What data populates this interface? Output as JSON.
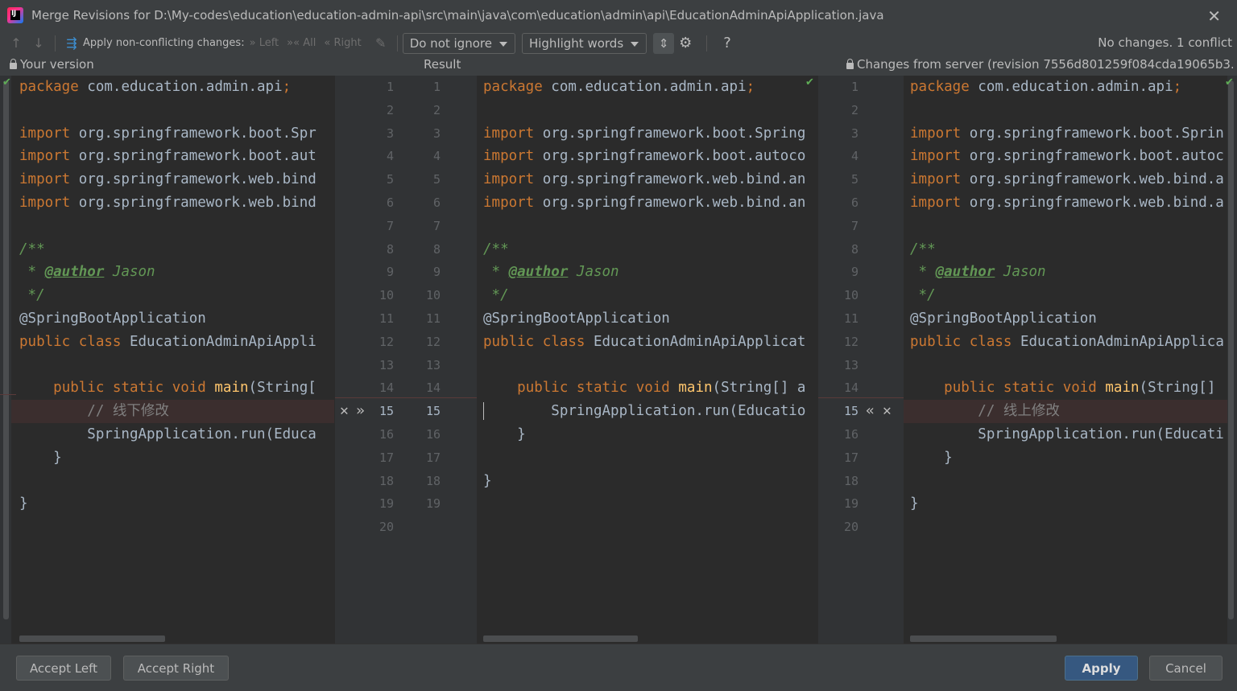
{
  "window": {
    "title": "Merge Revisions for D:\\My-codes\\education\\education-admin-api\\src\\main\\java\\com\\education\\admin\\api\\EducationAdminApiApplication.java",
    "logo_text": "IJ"
  },
  "toolbar": {
    "apply_label": "Apply non-conflicting changes:",
    "left_label": "Left",
    "all_label": "All",
    "right_label": "Right",
    "ignore_dropdown": "Do not ignore",
    "highlight_dropdown": "Highlight words",
    "status": "No changes. 1 conflict",
    "help": "?"
  },
  "panes": {
    "left_title": "Your version",
    "middle_title": "Result",
    "right_title": "Changes from server (revision 7556d801259f084cda19065b3..."
  },
  "left_code": [
    "package com.education.admin.api;",
    "",
    "import org.springframework.boot.Spr",
    "import org.springframework.boot.aut",
    "import org.springframework.web.bind",
    "import org.springframework.web.bind",
    "",
    "/**",
    " * @author Jason",
    " */",
    "@SpringBootApplication",
    "public class EducationAdminApiAppli",
    "",
    "    public static void main(String[",
    "        // 线下修改",
    "        SpringApplication.run(Educa",
    "    }",
    "",
    "}",
    ""
  ],
  "middle_code": [
    "package com.education.admin.api;",
    "",
    "import org.springframework.boot.Spring",
    "import org.springframework.boot.autoco",
    "import org.springframework.web.bind.an",
    "import org.springframework.web.bind.an",
    "",
    "/**",
    " * @author Jason",
    " */",
    "@SpringBootApplication",
    "public class EducationAdminApiApplicat",
    "",
    "    public static void main(String[] a",
    "        SpringApplication.run(Educatio",
    "    }",
    "",
    "}",
    ""
  ],
  "right_code": [
    "package com.education.admin.api;",
    "",
    "import org.springframework.boot.Sprin",
    "import org.springframework.boot.autoc",
    "import org.springframework.web.bind.a",
    "import org.springframework.web.bind.a",
    "",
    "/**",
    " * @author Jason",
    " */",
    "@SpringBootApplication",
    "public class EducationAdminApiApplica",
    "",
    "    public static void main(String[]",
    "        // 线上修改",
    "        SpringApplication.run(Educati",
    "    }",
    "",
    "}",
    ""
  ],
  "gutter": {
    "left_numbers": [
      "1",
      "2",
      "3",
      "4",
      "5",
      "6",
      "7",
      "8",
      "9",
      "10",
      "11",
      "12",
      "13",
      "14",
      "15",
      "16",
      "17",
      "18",
      "19",
      "20"
    ],
    "middle_numbers": [
      "1",
      "2",
      "3",
      "4",
      "5",
      "6",
      "7",
      "8",
      "9",
      "10",
      "11",
      "12",
      "13",
      "14",
      "15",
      "16",
      "17",
      "18",
      "19"
    ],
    "right_numbers": [
      "1",
      "2",
      "3",
      "4",
      "5",
      "6",
      "7",
      "8",
      "9",
      "10",
      "11",
      "12",
      "13",
      "14",
      "15",
      "16",
      "17",
      "18",
      "19",
      "20"
    ]
  },
  "buttons": {
    "accept_left": "Accept Left",
    "accept_right": "Accept Right",
    "apply": "Apply",
    "cancel": "Cancel"
  },
  "colors": {
    "keyword": "#cc7832",
    "comment": "#629755",
    "annotation": "#bbb529",
    "function": "#ffc66d",
    "line_comment": "#808080",
    "primary_button": "#365880"
  }
}
